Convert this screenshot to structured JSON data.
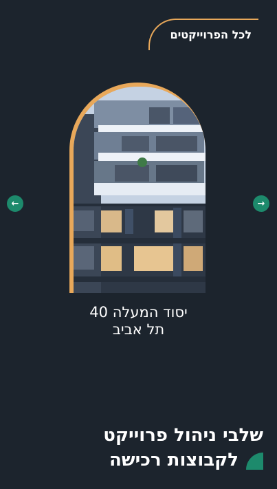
{
  "header": {
    "all_projects_label": "לכל הפרוייקטים"
  },
  "carousel": {
    "prev_icon": "arrow-left-icon",
    "next_icon": "arrow-right-icon",
    "project": {
      "title_line1": "יסוד המעלה 40",
      "title_line2": "תל אביב"
    }
  },
  "section": {
    "headline_line1": "שלבי ניהול פרוייקט",
    "headline_line2": "לקבוצות רכישה"
  },
  "colors": {
    "background": "#1c242d",
    "accent_orange": "#e8a85a",
    "accent_green": "#1d8a6c"
  }
}
